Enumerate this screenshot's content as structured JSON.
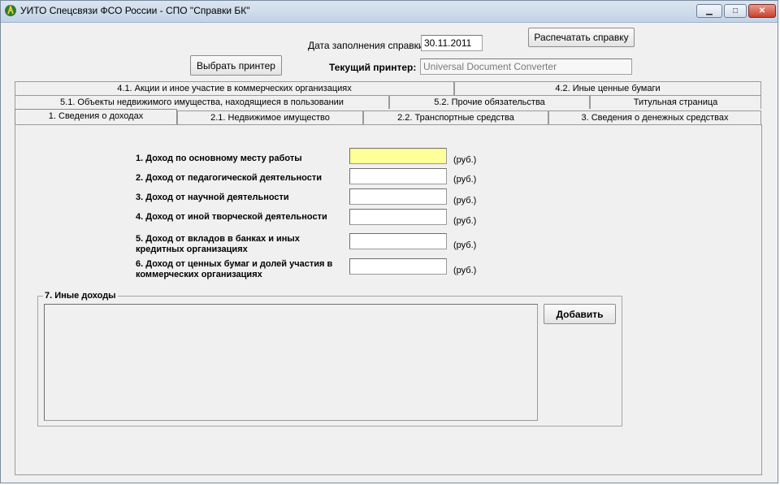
{
  "window": {
    "title": "УИТО Спецсвязи ФСО России - СПО \"Справки БК\"",
    "minimize_glyph": "▁",
    "maximize_glyph": "□",
    "close_glyph": "✕"
  },
  "header": {
    "date_label": "Дата заполнения справки",
    "date_value": "30.11.2011",
    "print_button": "Распечатать справку",
    "select_printer_button": "Выбрать принтер",
    "current_printer_label": "Текущий принтер:",
    "current_printer_value": "Universal Document Converter"
  },
  "tabs": {
    "row1": [
      "4.1. Акции и иное участие в коммерческих организациях",
      "4.2. Иные ценные бумаги"
    ],
    "row2": [
      "5.1. Объекты недвижимого имущества, находящиеся в пользовании",
      "5.2. Прочие обязательства",
      "Титульная страница"
    ],
    "row3": [
      "1. Сведения о доходах",
      "2.1. Недвижимое имущество",
      "2.2. Транспортные средства",
      "3. Сведения о денежных средствах"
    ],
    "active": "1. Сведения о доходах"
  },
  "income": {
    "rows": [
      {
        "label": "1. Доход по основному месту работы",
        "value": "",
        "unit": "(руб.)"
      },
      {
        "label": "2. Доход от педагогической деятельности",
        "value": "",
        "unit": "(руб.)"
      },
      {
        "label": "3. Доход от научной деятельности",
        "value": "",
        "unit": "(руб.)"
      },
      {
        "label": "4. Доход от иной творческой деятельности",
        "value": "",
        "unit": "(руб.)"
      },
      {
        "label": "5. Доход от вкладов в банках и иных кредитных организациях",
        "value": "",
        "unit": "(руб.)"
      },
      {
        "label": "6. Доход от ценных бумаг и долей участия в коммерческих организациях",
        "value": "",
        "unit": "(руб.)"
      }
    ],
    "focused_color": "#ffff99"
  },
  "other_income": {
    "title": "7. Иные доходы",
    "add_button": "Добавить"
  }
}
